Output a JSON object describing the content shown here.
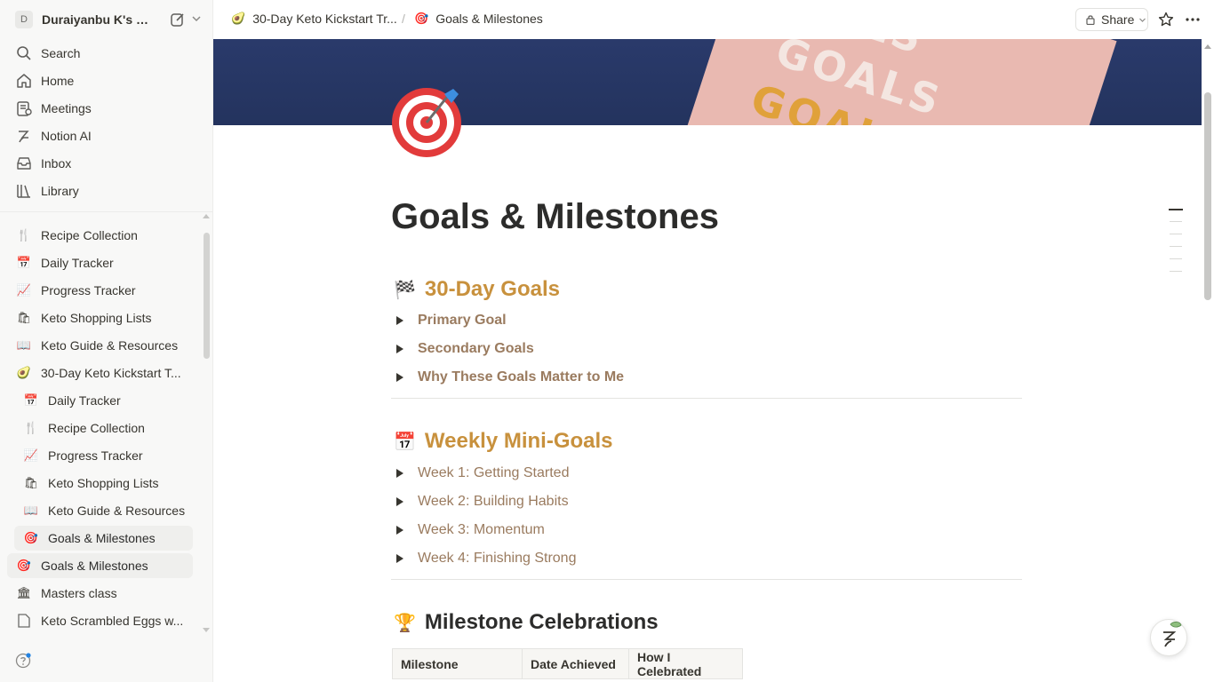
{
  "workspace": {
    "avatar_letter": "D",
    "name": "Duraiyanbu K's N..."
  },
  "nav": [
    {
      "label": "Search",
      "icon": "search-icon"
    },
    {
      "label": "Home",
      "icon": "home-icon"
    },
    {
      "label": "Meetings",
      "icon": "meetings-icon"
    },
    {
      "label": "Notion AI",
      "icon": "notion-ai-icon"
    },
    {
      "label": "Inbox",
      "icon": "inbox-icon"
    },
    {
      "label": "Library",
      "icon": "library-icon"
    }
  ],
  "pages": [
    {
      "emoji": "🍴",
      "label": "Recipe Collection"
    },
    {
      "emoji": "📅",
      "label": "Daily Tracker"
    },
    {
      "emoji": "📈",
      "label": "Progress Tracker"
    },
    {
      "emoji": "🛍",
      "label": "Keto Shopping Lists"
    },
    {
      "emoji": "📖",
      "label": "Keto Guide & Resources"
    },
    {
      "emoji": "🥑",
      "label": "30-Day Keto Kickstart T..."
    },
    {
      "emoji": "📅",
      "label": "Daily Tracker"
    },
    {
      "emoji": "🍴",
      "label": "Recipe Collection"
    },
    {
      "emoji": "📈",
      "label": "Progress Tracker"
    },
    {
      "emoji": "🛍",
      "label": "Keto Shopping Lists"
    },
    {
      "emoji": "📖",
      "label": "Keto Guide & Resources"
    },
    {
      "emoji": "🎯",
      "label": "Goals & Milestones"
    },
    {
      "emoji": "🎯",
      "label": "Goals & Milestones"
    },
    {
      "emoji": "🏛",
      "label": "Masters class"
    },
    {
      "emoji": "📄",
      "label": "Keto Scrambled Eggs w..."
    }
  ],
  "breadcrumb": [
    {
      "emoji": "🥑",
      "label": "30-Day Keto Kickstart Tr..."
    },
    {
      "emoji": "🎯",
      "label": "Goals & Milestones"
    }
  ],
  "breadcrumb_separator": "/",
  "share_label": "Share",
  "cover_words": [
    "GOALS",
    "GOALS",
    "GOALS"
  ],
  "page": {
    "title": "Goals & Milestones",
    "sections": [
      {
        "emoji": "🏁",
        "heading": "30-Day Goals",
        "toggles": [
          "Primary Goal",
          "Secondary Goals",
          "Why These Goals Matter to Me"
        ]
      },
      {
        "emoji": "📅",
        "heading": "Weekly Mini-Goals",
        "toggles": [
          "Week 1: Getting Started",
          "Week 2: Building Habits",
          "Week 3: Momentum",
          "Week 4: Finishing Strong"
        ]
      },
      {
        "emoji": "🏆",
        "heading": "Milestone Celebrations",
        "table_headers": [
          "Milestone",
          "Date Achieved",
          "How I Celebrated"
        ]
      }
    ]
  },
  "colors": {
    "heading_gold": "#c8913d",
    "toggle_brown": "#9a7b5f",
    "sidebar_bg": "#f8f8f7"
  }
}
